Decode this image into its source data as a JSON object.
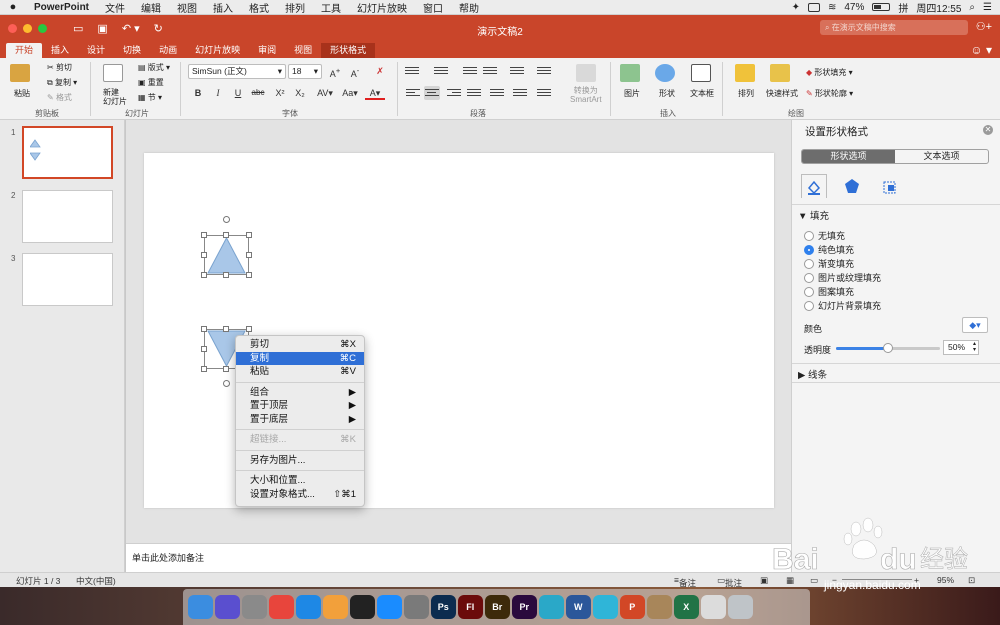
{
  "menubar": {
    "app_name": "PowerPoint",
    "items": [
      "文件",
      "编辑",
      "视图",
      "插入",
      "格式",
      "排列",
      "工具",
      "幻灯片放映",
      "窗口",
      "帮助"
    ],
    "battery": "47%",
    "clock": "周四12:55",
    "input_method": "拼"
  },
  "titlebar": {
    "title": "演示文稿2",
    "search_placeholder": "在演示文稿中搜索"
  },
  "ribbon_tabs": [
    "开始",
    "插入",
    "设计",
    "切换",
    "动画",
    "幻灯片放映",
    "审阅",
    "视图",
    "形状格式"
  ],
  "ribbon": {
    "paste": "粘贴",
    "cut": "剪切",
    "copy": "复制",
    "format": "格式",
    "clipboard_group": "剪贴板",
    "new_slide": "新建\n幻灯片",
    "layout": "版式",
    "reset": "重置",
    "section": "节",
    "slides_group": "幻灯片",
    "font_name": "SimSun (正文)",
    "font_size": "18",
    "font_group": "字体",
    "paragraph_group": "段落",
    "convert_smartart": "转换为\nSmartArt",
    "picture": "图片",
    "shapes": "形状",
    "textbox": "文本框",
    "insert_group": "插入",
    "arrange": "排列",
    "quick_styles": "快速样式",
    "shape_fill": "形状填充",
    "shape_outline": "形状轮廓",
    "drawing_group": "绘图"
  },
  "slides": {
    "numbers": [
      "1",
      "2",
      "3"
    ]
  },
  "notes_placeholder": "单击此处添加备注",
  "context_menu": {
    "items": [
      {
        "label": "剪切",
        "shortcut": "⌘X"
      },
      {
        "label": "复制",
        "shortcut": "⌘C"
      },
      {
        "label": "粘贴",
        "shortcut": "⌘V"
      },
      {
        "label": "组合",
        "shortcut": "▶"
      },
      {
        "label": "置于顶层",
        "shortcut": "▶"
      },
      {
        "label": "置于底层",
        "shortcut": "▶"
      },
      {
        "label": "超链接...",
        "shortcut": "⌘K"
      },
      {
        "label": "另存为图片..."
      },
      {
        "label": "大小和位置..."
      },
      {
        "label": "设置对象格式...",
        "shortcut": "⇧⌘1"
      }
    ]
  },
  "format_pane": {
    "title": "设置形状格式",
    "tab_shape": "形状选项",
    "tab_text": "文本选项",
    "fill_section": "填充",
    "fill_options": [
      "无填充",
      "纯色填充",
      "渐变填充",
      "图片或纹理填充",
      "图案填充",
      "幻灯片背景填充"
    ],
    "selected_fill": "纯色填充",
    "color_label": "颜色",
    "transparency_label": "透明度",
    "transparency_value": "50%",
    "transparency_fraction": 0.5,
    "line_section": "线条"
  },
  "statusbar": {
    "slide_info": "幻灯片 1 / 3",
    "language": "中文(中国)",
    "notes": "备注",
    "comments": "批注",
    "zoom": "95%"
  },
  "dock": {
    "apps": [
      {
        "icon": "finder-icon",
        "color": "#3b8de0",
        "label": ""
      },
      {
        "icon": "siri-icon",
        "color": "#5a4fcf",
        "label": ""
      },
      {
        "icon": "launchpad-icon",
        "color": "#8a8a8a",
        "label": ""
      },
      {
        "icon": "chrome-icon",
        "color": "#e8453c",
        "label": ""
      },
      {
        "icon": "safari-icon",
        "color": "#1e88e5",
        "label": ""
      },
      {
        "icon": "photos-icon",
        "color": "#f2a03b",
        "label": ""
      },
      {
        "icon": "qq-icon",
        "color": "#222222",
        "label": ""
      },
      {
        "icon": "app-store-icon",
        "color": "#1a8cff",
        "label": ""
      },
      {
        "icon": "system-preferences-icon",
        "color": "#7a7a7a",
        "label": ""
      },
      {
        "icon": "photoshop-icon",
        "color": "#0c2c4f",
        "label": "Ps"
      },
      {
        "icon": "flash-icon",
        "color": "#6b0b0b",
        "label": "Fl"
      },
      {
        "icon": "bridge-icon",
        "color": "#3d2a0a",
        "label": "Br"
      },
      {
        "icon": "premiere-icon",
        "color": "#2a0a3d",
        "label": "Pr"
      },
      {
        "icon": "browser-icon",
        "color": "#2aa8c8",
        "label": ""
      },
      {
        "icon": "word-icon",
        "color": "#2b579a",
        "label": "W"
      },
      {
        "icon": "wunderlist-icon",
        "color": "#2fb5d8",
        "label": ""
      },
      {
        "icon": "powerpoint-icon",
        "color": "#d24726",
        "label": "P"
      },
      {
        "icon": "archive-icon",
        "color": "#a8865a",
        "label": ""
      },
      {
        "icon": "excel-icon",
        "color": "#217346",
        "label": "X"
      },
      {
        "icon": "preview-icon",
        "color": "#dcdcdc",
        "label": ""
      },
      {
        "icon": "trash-icon",
        "color": "#bfc4c8",
        "label": ""
      }
    ]
  },
  "watermark": {
    "brand": "Bai",
    "brand_tail": "du",
    "cn": "经验",
    "url": "jingyan.baidu.com"
  },
  "colors": {
    "brand": "#c9452a",
    "shape_fill": "#a9c7e8",
    "shape_stroke": "#7aa3cf",
    "highlight": "#2f6fd6"
  }
}
